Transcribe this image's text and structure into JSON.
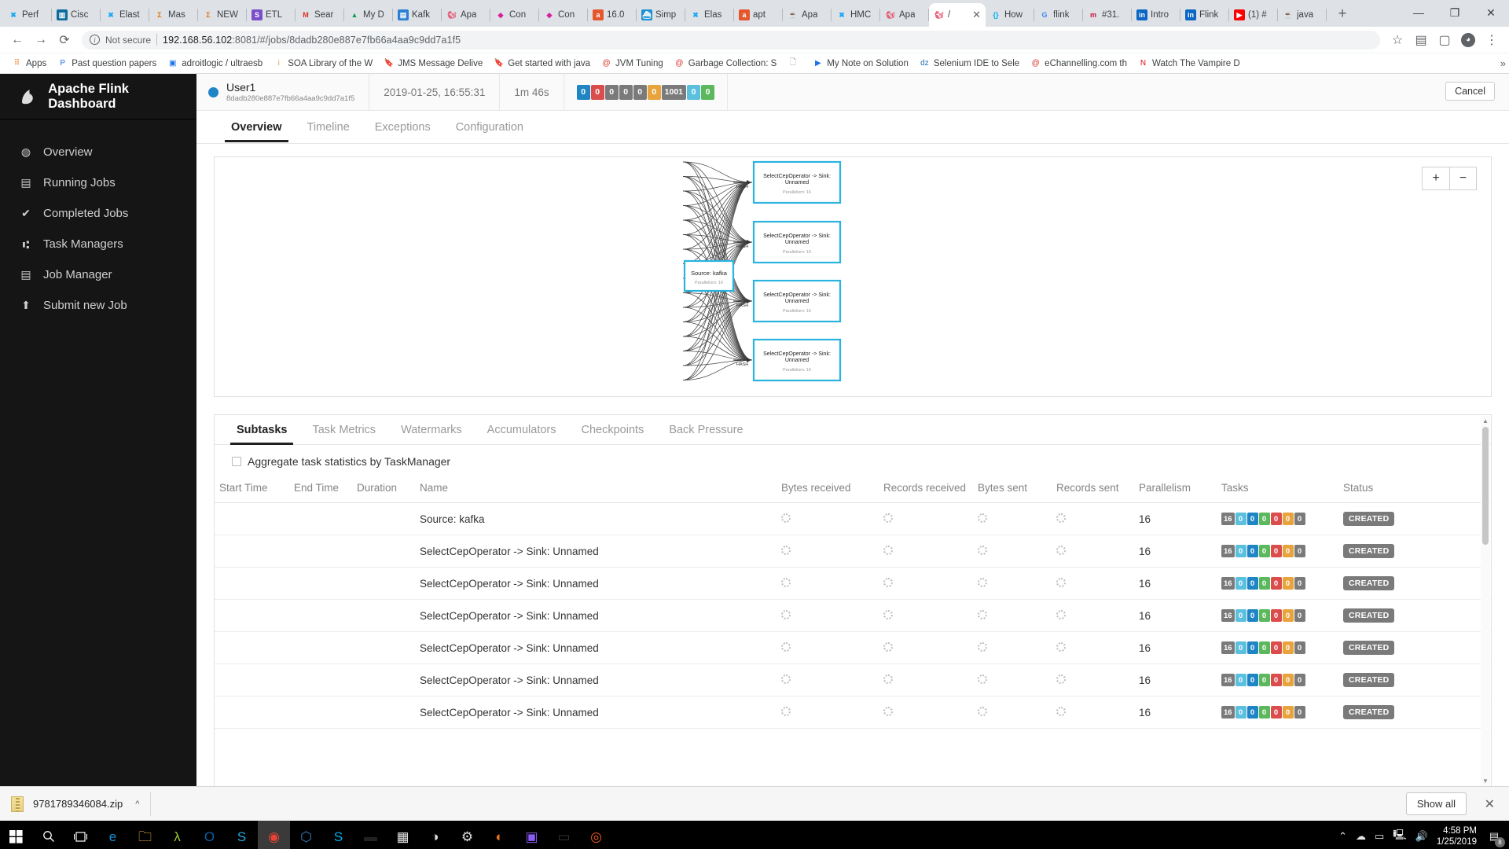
{
  "browser": {
    "tabs": [
      {
        "label": "Perf",
        "icon": "elastic-icon",
        "color": "#1ba9f5",
        "glyph": "✖"
      },
      {
        "label": "Cisc",
        "icon": "cisco-icon",
        "color": "#0d6b9e",
        "glyph": "▥"
      },
      {
        "label": "Elast",
        "icon": "elastic-icon",
        "color": "#1ba9f5",
        "glyph": "✖"
      },
      {
        "label": "Mas",
        "icon": "sigma-icon",
        "color": "#e8730b",
        "glyph": "Σ"
      },
      {
        "label": "NEW",
        "icon": "sigma-icon",
        "color": "#e8730b",
        "glyph": "Σ"
      },
      {
        "label": "ETL",
        "icon": "skype-icon",
        "color": "#7b4fc9",
        "glyph": "S"
      },
      {
        "label": "Sear",
        "icon": "gmail-icon",
        "color": "#d93025",
        "glyph": "M"
      },
      {
        "label": "My D",
        "icon": "gdrive-icon",
        "color": "#0f9d58",
        "glyph": "▲"
      },
      {
        "label": "Kafk",
        "icon": "doc-icon",
        "color": "#2a7fd4",
        "glyph": "▤"
      },
      {
        "label": "Apa",
        "icon": "flink-icon",
        "color": "#e6526f",
        "glyph": "🐿"
      },
      {
        "label": "Con",
        "icon": "confluence-icon",
        "color": "#d6219b",
        "glyph": "◆"
      },
      {
        "label": "Con",
        "icon": "confluence-icon",
        "color": "#d6219b",
        "glyph": "◆"
      },
      {
        "label": "16.0",
        "icon": "ask-icon",
        "color": "#e4572e",
        "glyph": "a"
      },
      {
        "label": "Simp",
        "icon": "docker-icon",
        "color": "#1d91d0",
        "glyph": "⛴"
      },
      {
        "label": "Elas",
        "icon": "elastic-icon",
        "color": "#1ba9f5",
        "glyph": "✖"
      },
      {
        "label": "apt",
        "icon": "ask-icon",
        "color": "#e4572e",
        "glyph": "a"
      },
      {
        "label": "Apa",
        "icon": "java-icon",
        "color": "#5382a1",
        "glyph": "☕"
      },
      {
        "label": "HMC",
        "icon": "elastic-icon",
        "color": "#1ba9f5",
        "glyph": "✖"
      },
      {
        "label": "Apa",
        "icon": "flink-icon",
        "color": "#e6526f",
        "glyph": "🐿"
      },
      {
        "label": "/",
        "icon": "flink-icon",
        "color": "#e6526f",
        "glyph": "🐿",
        "active": true
      },
      {
        "label": "How",
        "icon": "code-icon",
        "color": "#00b0f0",
        "glyph": "{}"
      },
      {
        "label": "flink",
        "icon": "google-icon",
        "color": "#4285f4",
        "glyph": "G"
      },
      {
        "label": "#31.",
        "icon": "medium-icon",
        "color": "#c8102e",
        "glyph": "m"
      },
      {
        "label": "Intro",
        "icon": "linkedin-icon",
        "color": "#0a66c2",
        "glyph": "in"
      },
      {
        "label": "Flink",
        "icon": "linkedin-icon",
        "color": "#0a66c2",
        "glyph": "in"
      },
      {
        "label": "(1) #",
        "icon": "youtube-icon",
        "color": "#ff0000",
        "glyph": "▶"
      },
      {
        "label": "java",
        "icon": "java-icon",
        "color": "#5382a1",
        "glyph": "☕"
      }
    ],
    "new_tab_label": "+",
    "window_controls": {
      "minimize": "—",
      "maximize": "❐",
      "close": "✕"
    },
    "nav": {
      "back": "←",
      "forward": "→",
      "reload": "⟳"
    },
    "security_label": "Not secure",
    "url_host": "192.168.56.102",
    "url_rest": ":8081/#/jobs/8dadb280e887e7fb66a4aa9c9dd7a1f5",
    "star_icon": "☆",
    "extension_icon": "▤",
    "profile_icon": "●",
    "menu_icon": "⋮",
    "bookmarks": [
      {
        "label": "Apps",
        "icon": "apps-grid-icon",
        "color": "#e8710a",
        "glyph": "⠿"
      },
      {
        "label": "Past question papers",
        "icon": "p-circle-icon",
        "color": "#1a73e8",
        "glyph": "P"
      },
      {
        "label": "adroitlogic / ultraesb",
        "icon": "github-icon",
        "color": "#1a73e8",
        "glyph": "▣"
      },
      {
        "label": "SOA Library of the W",
        "icon": "info-icon",
        "color": "#e8a33d",
        "glyph": "i"
      },
      {
        "label": "JMS Message Delive",
        "icon": "bookmark-icon",
        "color": "#f2a33c",
        "glyph": "🔖"
      },
      {
        "label": "Get started with java",
        "icon": "bookmark-icon",
        "color": "#f2a33c",
        "glyph": "🔖"
      },
      {
        "label": "JVM Tuning",
        "icon": "at-icon",
        "color": "#d93025",
        "glyph": "@"
      },
      {
        "label": "Garbage Collection: S",
        "icon": "at-icon",
        "color": "#d93025",
        "glyph": "@"
      },
      {
        "label": "",
        "icon": "page-icon",
        "color": "#9aa0a6",
        "glyph": "🗋"
      },
      {
        "label": "My Note on Solution",
        "icon": "play-icon",
        "color": "#1a73e8",
        "glyph": "▶"
      },
      {
        "label": "Selenium IDE to Sele",
        "icon": "dzone-icon",
        "color": "#1b6fb6",
        "glyph": "dz"
      },
      {
        "label": "eChannelling.com th",
        "icon": "at-icon",
        "color": "#d93025",
        "glyph": "@"
      },
      {
        "label": "Watch The Vampire D",
        "icon": "netflix-icon",
        "color": "#e50914",
        "glyph": "N"
      }
    ],
    "bookmarks_overflow": "»"
  },
  "sidebar": {
    "brand": "Apache Flink Dashboard",
    "logo_icon": "flink-squirrel-icon",
    "items": [
      {
        "label": "Overview",
        "icon": "dashboard-icon",
        "glyph": "◍"
      },
      {
        "label": "Running Jobs",
        "icon": "running-jobs-icon",
        "glyph": "▤"
      },
      {
        "label": "Completed Jobs",
        "icon": "check-circle-icon",
        "glyph": "✔"
      },
      {
        "label": "Task Managers",
        "icon": "sitemap-icon",
        "glyph": "⑆"
      },
      {
        "label": "Job Manager",
        "icon": "server-icon",
        "glyph": "▤"
      },
      {
        "label": "Submit new Job",
        "icon": "upload-icon",
        "glyph": "⬆"
      }
    ]
  },
  "job": {
    "status_dot_color": "#1f85c4",
    "name": "User1",
    "id": "8dadb280e887e7fb66a4aa9c9dd7a1f5",
    "start_time": "2019-01-25, 16:55:31",
    "duration": "1m 46s",
    "cancel_label": "Cancel",
    "status_badges": [
      {
        "value": "0",
        "color": "#1f85c4",
        "name": "created"
      },
      {
        "value": "0",
        "color": "#db4d4d",
        "name": "scheduled"
      },
      {
        "value": "0",
        "color": "#7a7a7a",
        "name": "deploying"
      },
      {
        "value": "0",
        "color": "#7a7a7a",
        "name": "running"
      },
      {
        "value": "0",
        "color": "#7a7a7a",
        "name": "finished"
      },
      {
        "value": "0",
        "color": "#e8a33d",
        "name": "canceling"
      },
      {
        "value": "1001",
        "color": "#7a7a7a",
        "name": "canceled"
      },
      {
        "value": "0",
        "color": "#5bc0de",
        "name": "failed"
      },
      {
        "value": "0",
        "color": "#5cb85c",
        "name": "reconciling"
      }
    ],
    "tabs": [
      {
        "label": "Overview",
        "active": true
      },
      {
        "label": "Timeline",
        "active": false
      },
      {
        "label": "Exceptions",
        "active": false
      },
      {
        "label": "Configuration",
        "active": false
      }
    ]
  },
  "graph": {
    "zoom_in_label": "+",
    "zoom_out_label": "−",
    "source_node": {
      "title": "Source: kafka",
      "subtitle": "Parallelism: 16"
    },
    "edge_label": "HASH",
    "operator_nodes": [
      {
        "title": "SelectCepOperator -> Sink:\nUnnamed",
        "line1": "SelectCepOperator -> Sink:",
        "line2": "Unnamed",
        "subtitle": "Parallelism: 16"
      },
      {
        "title": "SelectCepOperator -> Sink:\nUnnamed",
        "line1": "SelectCepOperator -> Sink:",
        "line2": "Unnamed",
        "subtitle": "Parallelism: 16"
      },
      {
        "title": "SelectCepOperator -> Sink:\nUnnamed",
        "line1": "SelectCepOperator -> Sink:",
        "line2": "Unnamed",
        "subtitle": "Parallelism: 16"
      },
      {
        "title": "SelectCepOperator -> Sink:\nUnnamed",
        "line1": "SelectCepOperator -> Sink:",
        "line2": "Unnamed",
        "subtitle": "Parallelism: 16"
      }
    ],
    "node_border_color": "#2bb3e0",
    "resize_handle": "⠿⠿"
  },
  "detail": {
    "tabs": [
      {
        "label": "Subtasks",
        "active": true
      },
      {
        "label": "Task Metrics",
        "active": false
      },
      {
        "label": "Watermarks",
        "active": false
      },
      {
        "label": "Accumulators",
        "active": false
      },
      {
        "label": "Checkpoints",
        "active": false
      },
      {
        "label": "Back Pressure",
        "active": false
      }
    ],
    "aggregate_checkbox_label": "Aggregate task statistics by TaskManager",
    "aggregate_checked": false,
    "columns": [
      "Start Time",
      "End Time",
      "Duration",
      "Name",
      "Bytes received",
      "Records received",
      "Bytes sent",
      "Records sent",
      "Parallelism",
      "Tasks",
      "Status"
    ],
    "rows": [
      {
        "start_time": "",
        "end_time": "",
        "duration": "",
        "name": "Source: kafka",
        "bytes_received": "loading",
        "records_received": "loading",
        "bytes_sent": "loading",
        "records_sent": "loading",
        "parallelism": "16",
        "tasks": [
          "16",
          "0",
          "0",
          "0",
          "0",
          "0",
          "0"
        ],
        "status": "CREATED"
      },
      {
        "start_time": "",
        "end_time": "",
        "duration": "",
        "name": "SelectCepOperator -> Sink: Unnamed",
        "bytes_received": "loading",
        "records_received": "loading",
        "bytes_sent": "loading",
        "records_sent": "loading",
        "parallelism": "16",
        "tasks": [
          "16",
          "0",
          "0",
          "0",
          "0",
          "0",
          "0"
        ],
        "status": "CREATED"
      },
      {
        "start_time": "",
        "end_time": "",
        "duration": "",
        "name": "SelectCepOperator -> Sink: Unnamed",
        "bytes_received": "loading",
        "records_received": "loading",
        "bytes_sent": "loading",
        "records_sent": "loading",
        "parallelism": "16",
        "tasks": [
          "16",
          "0",
          "0",
          "0",
          "0",
          "0",
          "0"
        ],
        "status": "CREATED"
      },
      {
        "start_time": "",
        "end_time": "",
        "duration": "",
        "name": "SelectCepOperator -> Sink: Unnamed",
        "bytes_received": "loading",
        "records_received": "loading",
        "bytes_sent": "loading",
        "records_sent": "loading",
        "parallelism": "16",
        "tasks": [
          "16",
          "0",
          "0",
          "0",
          "0",
          "0",
          "0"
        ],
        "status": "CREATED"
      },
      {
        "start_time": "",
        "end_time": "",
        "duration": "",
        "name": "SelectCepOperator -> Sink: Unnamed",
        "bytes_received": "loading",
        "records_received": "loading",
        "bytes_sent": "loading",
        "records_sent": "loading",
        "parallelism": "16",
        "tasks": [
          "16",
          "0",
          "0",
          "0",
          "0",
          "0",
          "0"
        ],
        "status": "CREATED"
      },
      {
        "start_time": "",
        "end_time": "",
        "duration": "",
        "name": "SelectCepOperator -> Sink: Unnamed",
        "bytes_received": "loading",
        "records_received": "loading",
        "bytes_sent": "loading",
        "records_sent": "loading",
        "parallelism": "16",
        "tasks": [
          "16",
          "0",
          "0",
          "0",
          "0",
          "0",
          "0"
        ],
        "status": "CREATED"
      },
      {
        "start_time": "",
        "end_time": "",
        "duration": "",
        "name": "SelectCepOperator -> Sink: Unnamed",
        "bytes_received": "loading",
        "records_received": "loading",
        "bytes_sent": "loading",
        "records_sent": "loading",
        "parallelism": "16",
        "tasks": [
          "16",
          "0",
          "0",
          "0",
          "0",
          "0",
          "0"
        ],
        "status": "CREATED"
      }
    ],
    "task_badge_colors": [
      "#7a7a7a",
      "#5bc0de",
      "#1f85c4",
      "#5cb85c",
      "#db4d4d",
      "#e8a33d",
      "#7a7a7a"
    ]
  },
  "downloads": {
    "file_name": "9781789346084.zip",
    "caret": "^",
    "show_all_label": "Show all",
    "close_label": "✕"
  },
  "taskbar": {
    "start_icon": "windows-icon",
    "search_icon": "search-icon",
    "taskview_icon": "task-view-icon",
    "apps": [
      {
        "name": "edge-icon",
        "glyph": "e",
        "color": "#1b8fd4",
        "open": true
      },
      {
        "name": "file-explorer-icon",
        "glyph": "🗀",
        "color": "#f5c451",
        "open": true
      },
      {
        "name": "anaconda-icon",
        "glyph": "λ",
        "color": "#9acd32",
        "open": false
      },
      {
        "name": "outlook-icon",
        "glyph": "O",
        "color": "#0a5fa8",
        "open": true
      },
      {
        "name": "skype-business-icon",
        "glyph": "S",
        "color": "#29a8e0",
        "open": true
      },
      {
        "name": "chrome-icon",
        "glyph": "◉",
        "color": "#ea4335",
        "open": true,
        "focus": true
      },
      {
        "name": "virtualbox-icon",
        "glyph": "⬡",
        "color": "#3b7fc4",
        "open": true
      },
      {
        "name": "skype-icon",
        "glyph": "S",
        "color": "#00aff0",
        "open": true
      },
      {
        "name": "terminal-icon",
        "glyph": "▬",
        "color": "#222222",
        "open": false
      },
      {
        "name": "calculator-icon",
        "glyph": "▦",
        "color": "#e8e8e8",
        "open": false
      },
      {
        "name": "opera-icon",
        "glyph": "◑",
        "color": "#dddddd",
        "open": false
      },
      {
        "name": "settings-icon",
        "glyph": "⚙",
        "color": "#dddddd",
        "open": false
      },
      {
        "name": "firefox-icon",
        "glyph": "◐",
        "color": "#e8721c",
        "open": false
      },
      {
        "name": "intellij-icon",
        "glyph": "▣",
        "color": "#8b5cf6",
        "open": true
      },
      {
        "name": "cmd-icon",
        "glyph": "▭",
        "color": "#333333",
        "open": true
      },
      {
        "name": "postman-icon",
        "glyph": "◎",
        "color": "#ef5b25",
        "open": true
      }
    ],
    "tray": {
      "chevron": "⌃",
      "icons": [
        "cloud-sync-icon",
        "battery-icon",
        "network-icon",
        "volume-icon"
      ],
      "time": "4:58 PM",
      "date": "1/25/2019",
      "notification_count": "8"
    }
  }
}
